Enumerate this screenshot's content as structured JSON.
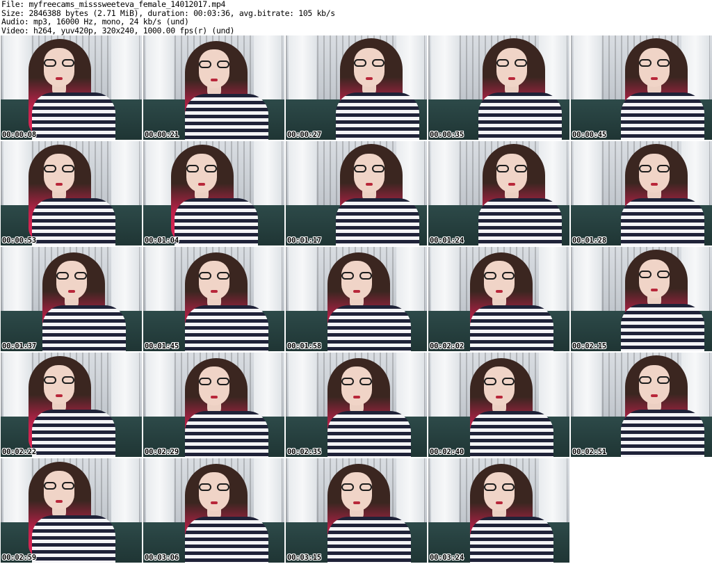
{
  "header": {
    "line1": "File: myfreecams_misssweeteva_female_14012017.mp4",
    "line2": "Size: 2846388 bytes (2.71 MiB), duration: 00:03:36, avg.bitrate: 105 kb/s",
    "line3": "Audio: mp3, 16000 Hz, mono, 24 kb/s (und)",
    "line4": "Video: h264, yuv420p, 320x240, 1000.00 fps(r) (und)"
  },
  "thumbnails": [
    {
      "timestamp": "00:00:08",
      "pose": 0
    },
    {
      "timestamp": "00:00:21",
      "pose": 1
    },
    {
      "timestamp": "00:00:27",
      "pose": 2
    },
    {
      "timestamp": "00:00:35",
      "pose": 2
    },
    {
      "timestamp": "00:00:45",
      "pose": 2
    },
    {
      "timestamp": "00:00:53",
      "pose": 0
    },
    {
      "timestamp": "00:01:04",
      "pose": 0
    },
    {
      "timestamp": "00:01:17",
      "pose": 2
    },
    {
      "timestamp": "00:01:24",
      "pose": 2
    },
    {
      "timestamp": "00:01:28",
      "pose": 2
    },
    {
      "timestamp": "00:01:37",
      "pose": 1
    },
    {
      "timestamp": "00:01:45",
      "pose": 1
    },
    {
      "timestamp": "00:01:58",
      "pose": 1
    },
    {
      "timestamp": "00:02:02",
      "pose": 1
    },
    {
      "timestamp": "00:02:15",
      "pose": 2
    },
    {
      "timestamp": "00:02:22",
      "pose": 0
    },
    {
      "timestamp": "00:02:29",
      "pose": 1
    },
    {
      "timestamp": "00:02:35",
      "pose": 1
    },
    {
      "timestamp": "00:02:40",
      "pose": 1
    },
    {
      "timestamp": "00:02:51",
      "pose": 2
    },
    {
      "timestamp": "00:02:59",
      "pose": 0
    },
    {
      "timestamp": "00:03:06",
      "pose": 1
    },
    {
      "timestamp": "00:03:15",
      "pose": 1
    },
    {
      "timestamp": "00:03:24",
      "pose": 1
    }
  ]
}
